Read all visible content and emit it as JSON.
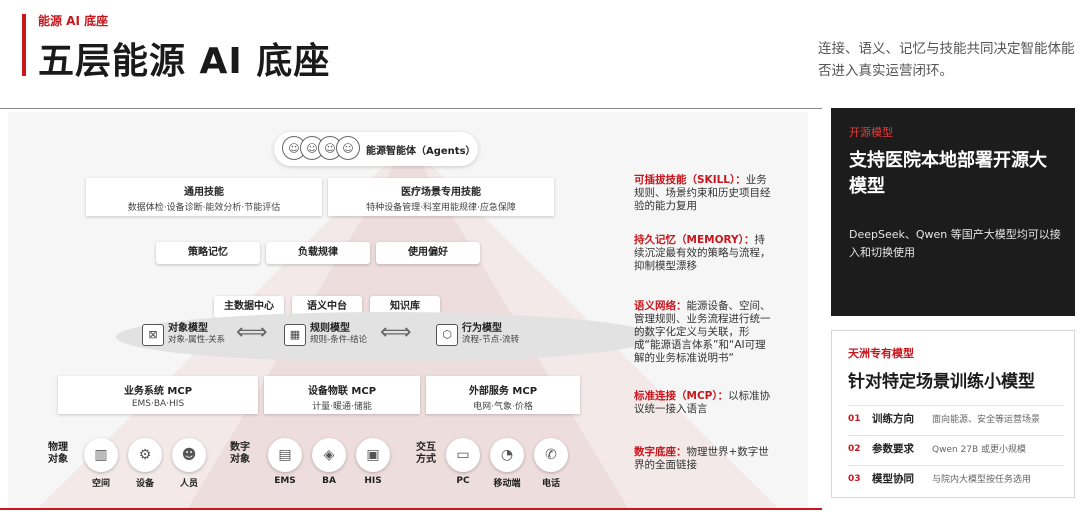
{
  "header": {
    "kicker": "能源 AI 底座",
    "title": "五层能源 AI 底座",
    "description": "连接、语义、记忆与技能共同决定智能体能否进入真实运营闭环。"
  },
  "agents": {
    "label": "能源智能体（Agents）"
  },
  "skills": [
    {
      "title": "通用技能",
      "sub": "数据体检·设备诊断·能效分析·节能评估"
    },
    {
      "title": "医疗场景专用技能",
      "sub": "特种设备管理·科室用能规律·应急保障"
    }
  ],
  "memory": [
    "策略记忆",
    "负载规律",
    "使用偏好"
  ],
  "semantic_top": [
    "主数据中心",
    "语义中台",
    "知识库"
  ],
  "models": [
    {
      "title": "对象模型",
      "sub": "对象-属性-关系"
    },
    {
      "title": "规则模型",
      "sub": "规则-条件-结论"
    },
    {
      "title": "行为模型",
      "sub": "流程-节点-流转"
    }
  ],
  "mcp": [
    {
      "title": "业务系统 MCP",
      "sub": "EMS·BA·HIS"
    },
    {
      "title": "设备物联 MCP",
      "sub": "计量·暖通·储能"
    },
    {
      "title": "外部服务 MCP",
      "sub": "电网·气象·价格"
    }
  ],
  "base": {
    "groups": [
      "物理对象",
      "数字对象",
      "交互方式"
    ],
    "items": [
      "空间",
      "设备",
      "人员",
      "EMS",
      "BA",
      "HIS",
      "PC",
      "移动端",
      "电话"
    ]
  },
  "annotations": [
    {
      "key": "可插拔技能（SKILL）：",
      "text": "业务规则、场景约束和历史项目经验的能力复用"
    },
    {
      "key": "持久记忆（MEMORY）：",
      "text": "持续沉淀最有效的策略与流程，抑制模型漂移"
    },
    {
      "key": "语义网络：",
      "text": "能源设备、空间、管理规则、业务流程进行统一的数字化定义与关联，形成“能源语言体系”和“AI可理解的业务标准说明书“"
    },
    {
      "key": "标准连接（MCP）：",
      "text": "以标准协议统一接入语言"
    },
    {
      "key": "数字底座：",
      "text": "物理世界+数字世界的全面链接"
    }
  ],
  "card_dark": {
    "tag": "开源模型",
    "heading": "支持医院本地部署开源大模型",
    "body": "DeepSeek、Qwen 等国产大模型均可以接入和切换使用"
  },
  "card_light": {
    "tag": "天洲专有模型",
    "heading": "针对特定场景训练小模型",
    "rows": [
      {
        "num": "01",
        "label": "训练方向",
        "value": "面向能源、安全等运营场景"
      },
      {
        "num": "02",
        "label": "参数要求",
        "value": "Qwen 27B 或更小规模"
      },
      {
        "num": "03",
        "label": "模型协同",
        "value": "与院内大模型按任务选用"
      }
    ]
  },
  "colors": {
    "accent": "#c8161d",
    "dark_card": "#1c1c1c"
  }
}
